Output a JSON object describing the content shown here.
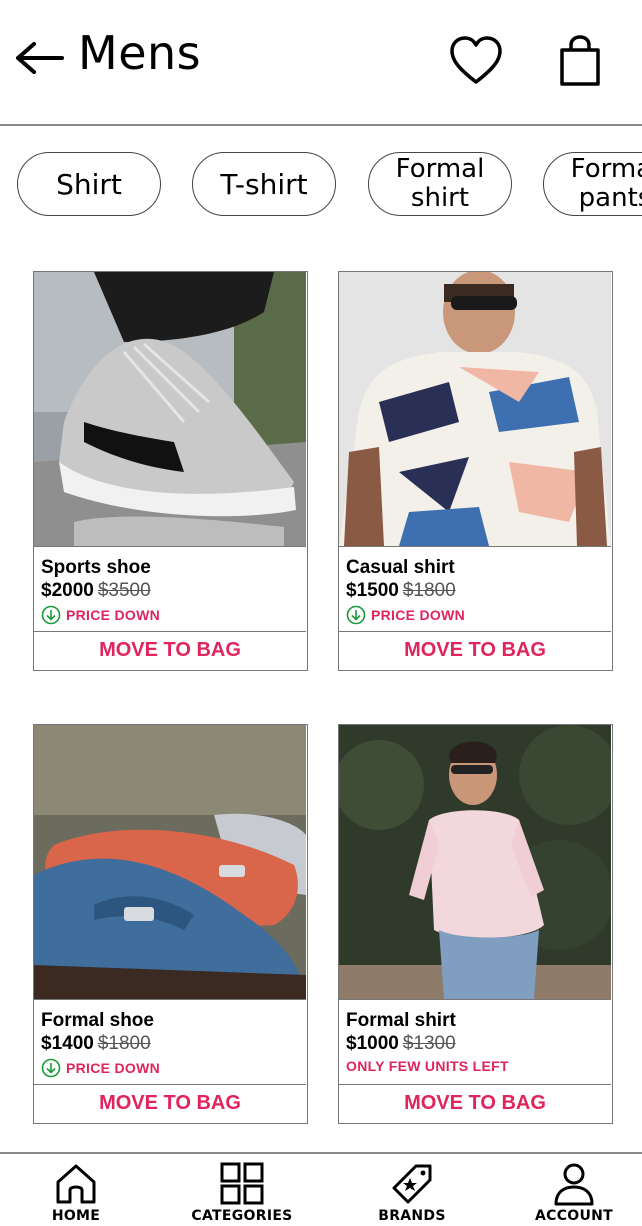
{
  "header": {
    "title": "Mens",
    "icons": {
      "back": "arrow-left-icon",
      "wishlist": "heart-icon",
      "bag": "shopping-bag-icon"
    }
  },
  "filters": [
    "Shirt",
    "T-shirt",
    "Formal\nshirt",
    "Formal\npants"
  ],
  "products": [
    {
      "name": "Sports shoe",
      "price": "$2000",
      "old_price": "$3500",
      "tag": "PRICE DOWN",
      "tag_icon": "arrow-down-circle-icon",
      "action": "MOVE TO BAG"
    },
    {
      "name": "Casual shirt",
      "price": "$1500",
      "old_price": "$1800",
      "tag": "PRICE DOWN",
      "tag_icon": "arrow-down-circle-icon",
      "action": "MOVE TO BAG"
    },
    {
      "name": "Formal shoe",
      "price": "$1400",
      "old_price": "$1800",
      "tag": "PRICE DOWN",
      "tag_icon": "arrow-down-circle-icon",
      "action": "MOVE TO BAG"
    },
    {
      "name": "Formal shirt",
      "price": "$1000",
      "old_price": "$1300",
      "tag": "ONLY FEW UNITS LEFT",
      "tag_icon": "",
      "action": "MOVE TO BAG"
    }
  ],
  "bottom_nav": [
    {
      "label": "HOME",
      "icon": "home-icon"
    },
    {
      "label": "CATEGORIES",
      "icon": "grid-icon"
    },
    {
      "label": "BRANDS",
      "icon": "brand-tag-icon"
    },
    {
      "label": "ACCOUNT",
      "icon": "user-icon"
    }
  ],
  "colors": {
    "accent": "#e0245e",
    "price_down": "#1a9a3a",
    "border": "#777777"
  }
}
